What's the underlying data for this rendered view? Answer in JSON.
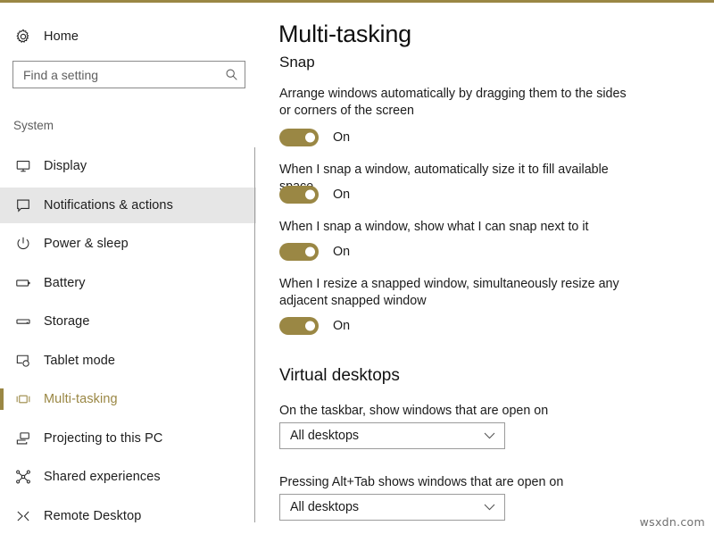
{
  "window": {
    "accent_color": "#9a8744",
    "background": "#ffffff"
  },
  "sidebar": {
    "home_label": "Home",
    "home_icon": "gear-icon",
    "search": {
      "placeholder": "Find a setting",
      "value": "",
      "icon": "search-icon"
    },
    "section_label": "System",
    "items": [
      {
        "label": "Display",
        "icon": "monitor-icon",
        "state": "normal"
      },
      {
        "label": "Notifications & actions",
        "icon": "speech-bubble-icon",
        "state": "hovered"
      },
      {
        "label": "Power & sleep",
        "icon": "power-icon",
        "state": "normal"
      },
      {
        "label": "Battery",
        "icon": "battery-icon",
        "state": "normal"
      },
      {
        "label": "Storage",
        "icon": "storage-icon",
        "state": "normal"
      },
      {
        "label": "Tablet mode",
        "icon": "tablet-mode-icon",
        "state": "normal"
      },
      {
        "label": "Multi-tasking",
        "icon": "multitasking-icon",
        "state": "selected"
      },
      {
        "label": "Projecting to this PC",
        "icon": "projecting-icon",
        "state": "normal"
      },
      {
        "label": "Shared experiences",
        "icon": "shared-icon",
        "state": "normal"
      },
      {
        "label": "Remote Desktop",
        "icon": "remote-desktop-icon",
        "state": "normal"
      }
    ]
  },
  "main": {
    "title": "Multi-tasking",
    "snap": {
      "heading": "Snap",
      "settings": [
        {
          "description": "Arrange windows automatically by dragging them to the sides or corners of the screen",
          "toggle_state": "On",
          "toggle_on": true
        },
        {
          "description": "When I snap a window, automatically size it to fill available space",
          "toggle_state": "On",
          "toggle_on": true
        },
        {
          "description": "When I snap a window, show what I can snap next to it",
          "toggle_state": "On",
          "toggle_on": true
        },
        {
          "description": "When I resize a snapped window, simultaneously resize any adjacent snapped window",
          "toggle_state": "On",
          "toggle_on": true
        }
      ]
    },
    "virtual_desktops": {
      "heading": "Virtual desktops",
      "settings": [
        {
          "description": "On the taskbar, show windows that are open on",
          "selected": "All desktops"
        },
        {
          "description": "Pressing Alt+Tab shows windows that are open on",
          "selected": "All desktops"
        }
      ]
    }
  },
  "watermark": "wsxdn.com"
}
